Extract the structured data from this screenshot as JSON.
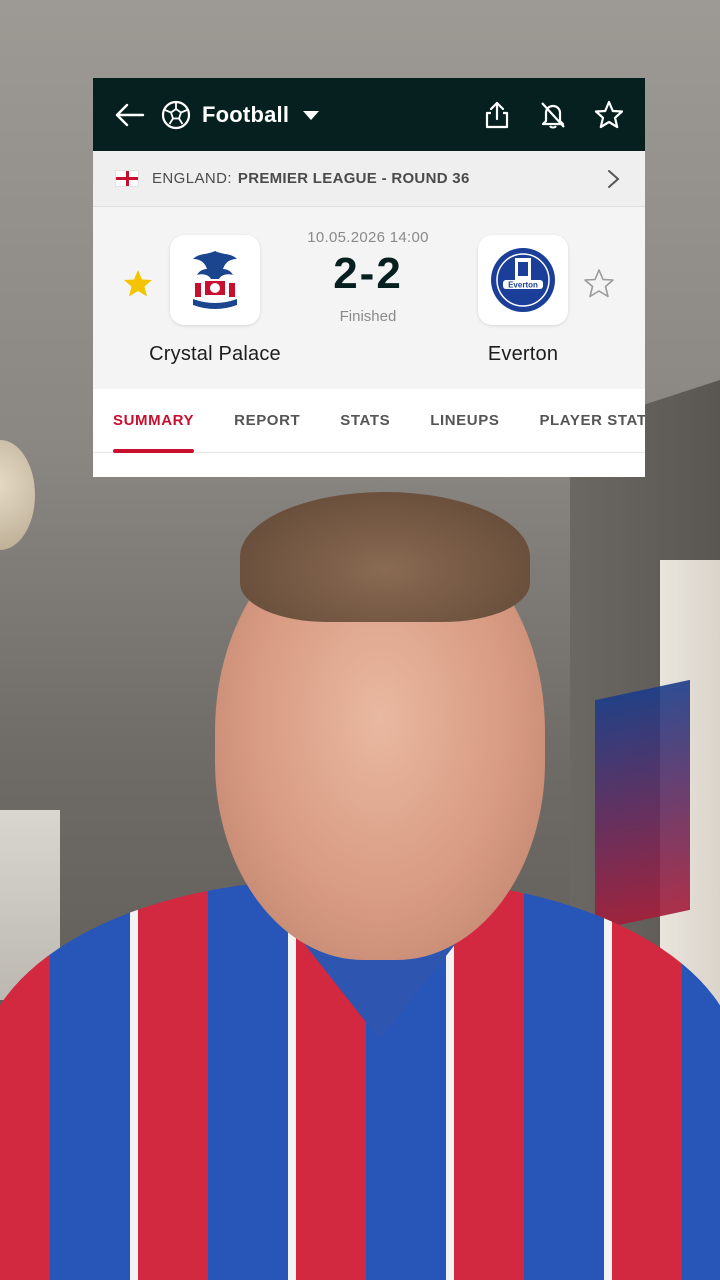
{
  "header": {
    "sport_label": "Football",
    "icons": [
      "back-arrow-icon",
      "soccer-ball-icon",
      "caret-down-icon",
      "share-icon",
      "bell-off-icon",
      "star-outline-icon"
    ]
  },
  "league": {
    "country": "ENGLAND:",
    "competition": "PREMIER LEAGUE - ROUND 36"
  },
  "match": {
    "datetime": "10.05.2026 14:00",
    "score": "2-2",
    "status": "Finished",
    "home": {
      "name": "Crystal Palace",
      "favorited": true
    },
    "away": {
      "name": "Everton",
      "favorited": false
    }
  },
  "tabs": [
    {
      "label": "SUMMARY",
      "active": true
    },
    {
      "label": "REPORT",
      "active": false
    },
    {
      "label": "STATS",
      "active": false
    },
    {
      "label": "LINEUPS",
      "active": false
    },
    {
      "label": "PLAYER STATS",
      "active": false
    }
  ],
  "colors": {
    "header_bg": "#06201f",
    "accent": "#c8102e",
    "star_favorite": "#f4c400"
  }
}
